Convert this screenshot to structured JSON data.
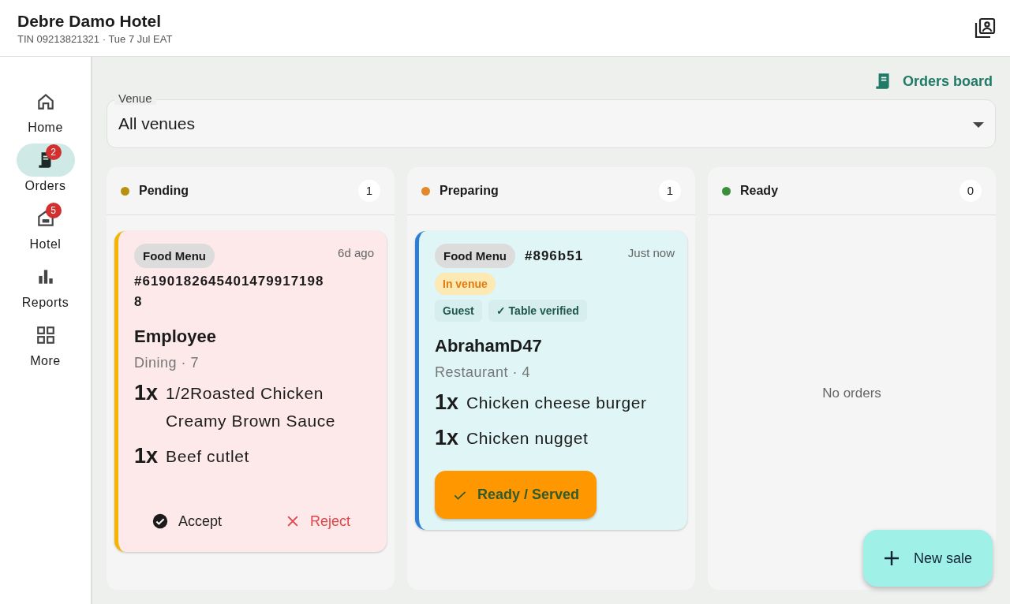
{
  "header": {
    "title": "Debre Damo Hotel",
    "subtitle": "TIN 09213821321 · Tue 7 Jul EAT"
  },
  "nav": [
    {
      "label": "Home",
      "selected": false
    },
    {
      "label": "Orders",
      "badge": "2",
      "selected": true
    },
    {
      "label": "Hotel",
      "badge": "5",
      "selected": false
    },
    {
      "label": "Reports",
      "selected": false
    },
    {
      "label": "More",
      "selected": false
    }
  ],
  "orders_board": "Orders board",
  "venue": {
    "label": "Venue",
    "value": "All venues"
  },
  "columns": [
    {
      "title": "Pending",
      "color": "#b8900f",
      "count": "1",
      "orders": [
        {
          "kind": "pending",
          "channel": "Food Menu",
          "number": "#61901826454014799171988",
          "time": "6d ago",
          "customer": "Employee",
          "location": "Dining · 7",
          "items": [
            {
              "qty": "1x",
              "name": "1/2Roasted Chicken Creamy Brown Sauce"
            },
            {
              "qty": "1x",
              "name": "Beef cutlet"
            }
          ],
          "actions": [
            {
              "kind": "accept",
              "label": "Accept"
            },
            {
              "kind": "reject",
              "label": "Reject"
            }
          ]
        }
      ]
    },
    {
      "title": "Preparing",
      "color": "#e08a2c",
      "count": "1",
      "orders": [
        {
          "kind": "preparing",
          "channel": "Food Menu",
          "number": "#896b51",
          "time": "Just now",
          "badges": [
            "In venue"
          ],
          "tags": [
            "Guest",
            "✓ Table verified"
          ],
          "customer": "AbrahamD47",
          "location": "Restaurant · 4",
          "items": [
            {
              "qty": "1x",
              "name": "Chicken cheese burger"
            },
            {
              "qty": "1x",
              "name": "Chicken nugget"
            }
          ],
          "actions": [
            {
              "kind": "ready",
              "label": "Ready / Served"
            }
          ]
        }
      ]
    },
    {
      "title": "Ready",
      "color": "#3a8f3a",
      "count": "0",
      "empty_text": "No orders"
    }
  ],
  "fab": "New sale"
}
